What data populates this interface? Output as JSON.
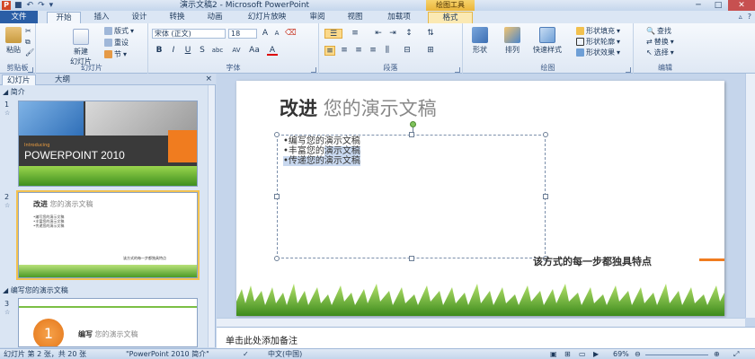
{
  "titlebar": {
    "app_letter": "P",
    "title": "演示文稿2 - Microsoft PowerPoint",
    "context_tool": "绘图工具",
    "minimize": "─",
    "maximize": "□",
    "close": "✕"
  },
  "tabs": {
    "file": "文件",
    "home": "开始",
    "insert": "插入",
    "design": "设计",
    "transitions": "转换",
    "animations": "动画",
    "slideshow": "幻灯片放映",
    "review": "审阅",
    "view": "视图",
    "addins": "加载项",
    "format": "格式"
  },
  "ribbon": {
    "clipboard": {
      "paste": "粘贴",
      "label": "剪贴板"
    },
    "slides": {
      "new_slide": "新建\n幻灯片",
      "layout": "版式",
      "reset": "重设",
      "section": "节",
      "label": "幻灯片"
    },
    "font": {
      "font_name": "宋体 (正文)",
      "font_size": "18",
      "bold": "B",
      "italic": "I",
      "underline": "U",
      "strike": "S",
      "shadow": "abc",
      "spacing": "AV",
      "case": "Aa",
      "color": "A",
      "label": "字体"
    },
    "paragraph": {
      "label": "段落"
    },
    "drawing": {
      "shapes": "形状",
      "arrange": "排列",
      "quick_styles": "快速样式",
      "fill": "形状填充",
      "outline": "形状轮廓",
      "effects": "形状效果",
      "label": "绘图"
    },
    "editing": {
      "find": "查找",
      "replace": "替换",
      "select": "选择",
      "label": "编辑"
    }
  },
  "leftpane": {
    "tab_slides": "幻灯片",
    "tab_outline": "大纲",
    "close": "×",
    "section1": "◢ 简介",
    "section2": "◢ 编写您的演示文稿",
    "slide1": {
      "num": "1",
      "intro": "Introducing",
      "title": "POWERPOINT 2010"
    },
    "slide2": {
      "num": "2",
      "title_bold": "改进",
      "title_rest": "您的演示文稿",
      "lines": [
        "•编写您的演示文稿",
        "•丰富您的演示文稿",
        "•传递您的演示文稿"
      ],
      "footer": "该方式的每一步都独具特点"
    },
    "slide3": {
      "num": "3",
      "circle_num": "1",
      "title_bold": "编写",
      "title_rest": "您的演示文稿"
    }
  },
  "slide": {
    "title_bold": "改进",
    "title_rest": " 您的演示文稿",
    "bullet1": "•编写您的演示文稿",
    "bullet2_a": "•丰富您的",
    "bullet2_b": "演示文稿",
    "bullet3": "•传递您的演示文稿",
    "footer_note": "该方式的每一步都独具特点"
  },
  "notes": {
    "placeholder": "单击此处添加备注"
  },
  "status": {
    "slide_info": "幻灯片 第 2 张，共 20 张",
    "theme": "\"PowerPoint 2010 简介\"",
    "language": "中文(中国)",
    "zoom": "69%"
  },
  "colors": {
    "file_tab": "#2a5ea6",
    "accent_orange": "#f07c1f",
    "context": "#eab53a"
  }
}
